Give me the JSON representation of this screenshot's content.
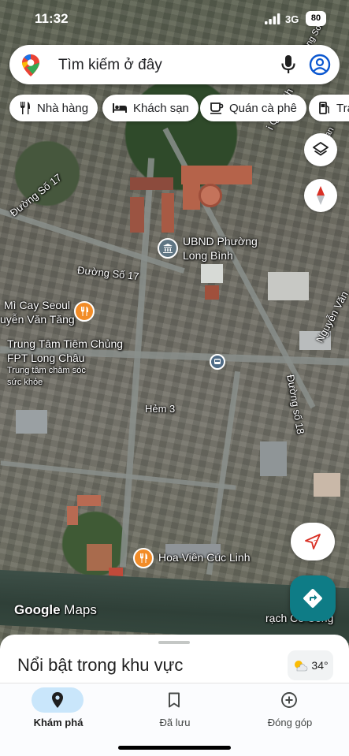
{
  "status_bar": {
    "time": "11:32",
    "network": "3G",
    "battery": "80"
  },
  "search": {
    "placeholder": "Tìm kiếm ở đây",
    "icons": [
      "maps-logo-icon",
      "mic-icon",
      "account-icon"
    ]
  },
  "chips": [
    {
      "label": "Nhà hàng",
      "icon": "restaurant-icon"
    },
    {
      "label": "Khách sạn",
      "icon": "hotel-icon"
    },
    {
      "label": "Quán cà phê",
      "icon": "coffee-icon"
    },
    {
      "label": "Trạ",
      "icon": "gas-station-icon"
    }
  ],
  "map": {
    "labels": {
      "duong_so_17_a": "Đường Số 17",
      "duong_so_17_b": "Đường Số 17",
      "ubnd_1": "UBND Phường",
      "ubnd_2": "Long Bình",
      "mi_cay_1": "Mì Cay Seoul",
      "mi_cay_2": "uyễn Văn Tăng",
      "fpt_1": "Trung Tâm Tiêm Chủng",
      "fpt_2": "FPT Long Châu",
      "fpt_3": "Trung tâm chăm sóc",
      "fpt_4": "sức khỏe",
      "hem_3": "Hẻm 3",
      "duong_so_18": "Đường số 18",
      "hoa_vien": "Hoa Viên Cúc Linh",
      "rach": "rạch Cỏ Công",
      "nguyen_van": "Nguyễn Văn",
      "quoc_lo": "i Quốc Kh",
      "dong_s": "ồng Sơn",
      "an": "an"
    },
    "watermark": {
      "google": "Google",
      "maps": "Maps"
    }
  },
  "colors": {
    "accent_blue": "#0b57d0",
    "poi_orange": "#f28c28",
    "directions_teal": "#0e7c86",
    "compass_red": "#d93025"
  },
  "sheet": {
    "title": "Nổi bật trong khu vực",
    "weather_temp": "34°"
  },
  "nav": [
    {
      "label": "Khám phá",
      "icon": "explore-pin-icon",
      "active": true
    },
    {
      "label": "Đã lưu",
      "icon": "bookmark-icon",
      "active": false
    },
    {
      "label": "Đóng góp",
      "icon": "add-circle-icon",
      "active": false
    }
  ]
}
